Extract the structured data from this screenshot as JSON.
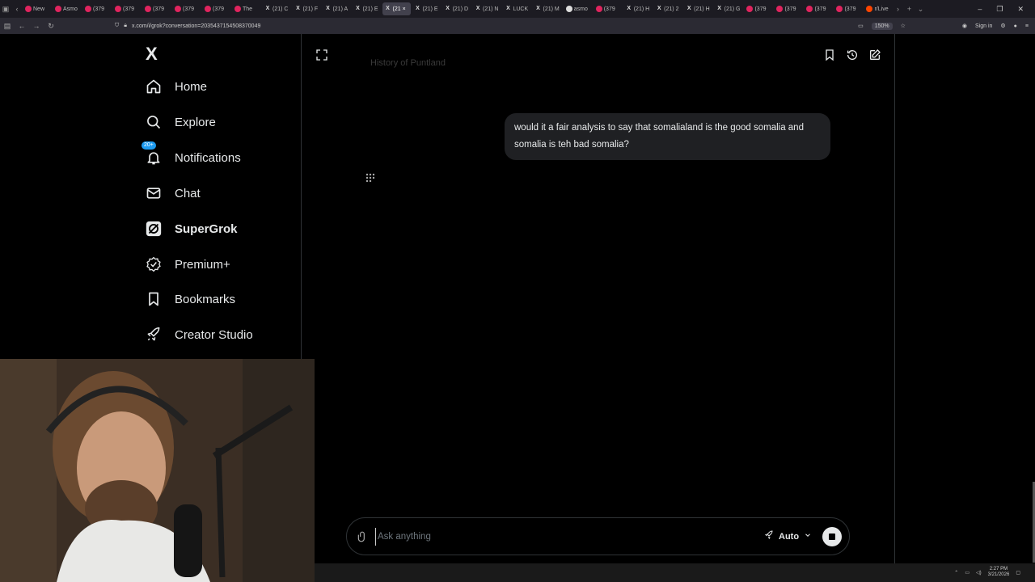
{
  "browser": {
    "tabs": [
      {
        "label": "New",
        "fav": "red"
      },
      {
        "label": "Asmo",
        "fav": "red"
      },
      {
        "label": "(379",
        "fav": "red"
      },
      {
        "label": "(379",
        "fav": "red"
      },
      {
        "label": "(379",
        "fav": "red"
      },
      {
        "label": "(379",
        "fav": "red"
      },
      {
        "label": "(379",
        "fav": "red"
      },
      {
        "label": "The",
        "fav": "red"
      },
      {
        "label": "(21) C",
        "fav": "x"
      },
      {
        "label": "(21) F",
        "fav": "x"
      },
      {
        "label": "(21) A",
        "fav": "x"
      },
      {
        "label": "(21) E",
        "fav": "x"
      },
      {
        "label": "(21",
        "fav": "x",
        "active": true
      },
      {
        "label": "(21) E",
        "fav": "x"
      },
      {
        "label": "(21) D",
        "fav": "x"
      },
      {
        "label": "(21) N",
        "fav": "x"
      },
      {
        "label": "LUCK",
        "fav": "x"
      },
      {
        "label": "(21) M",
        "fav": "x"
      },
      {
        "label": "asmo",
        "fav": "gr"
      },
      {
        "label": "(379",
        "fav": "red"
      },
      {
        "label": "(21) H",
        "fav": "x"
      },
      {
        "label": "(21) 2",
        "fav": "x"
      },
      {
        "label": "(21) H",
        "fav": "x"
      },
      {
        "label": "(21) G",
        "fav": "x"
      },
      {
        "label": "(379",
        "fav": "red"
      },
      {
        "label": "(379",
        "fav": "red"
      },
      {
        "label": "(379",
        "fav": "red"
      },
      {
        "label": "(379",
        "fav": "red"
      },
      {
        "label": "r/Live",
        "fav": "or"
      }
    ],
    "url": "x.com/i/grok?conversation=2035437154508370049",
    "zoom": "150%",
    "sign_in": "Sign in"
  },
  "sidebar": {
    "logo": "X",
    "items": [
      {
        "label": "Home",
        "icon": "home-icon"
      },
      {
        "label": "Explore",
        "icon": "search-icon"
      },
      {
        "label": "Notifications",
        "icon": "bell-icon",
        "badge": "20+"
      },
      {
        "label": "Chat",
        "icon": "mail-icon"
      },
      {
        "label": "SuperGrok",
        "icon": "grok-icon",
        "bold": true
      },
      {
        "label": "Premium+",
        "icon": "verified-icon"
      },
      {
        "label": "Bookmarks",
        "icon": "bookmark-icon"
      },
      {
        "label": "Creator Studio",
        "icon": "rocket-icon"
      }
    ]
  },
  "chat": {
    "faded_text": "History of Puntland",
    "user_message": "would it a fair analysis to say that somalialand is the good somalia and somalia is teh bad somalia?"
  },
  "composer": {
    "placeholder": "Ask anything",
    "mode_label": "Auto"
  },
  "taskbar": {
    "time": "2:27 PM",
    "date": "3/21/2026"
  },
  "colors": {
    "background": "#000000",
    "bubble": "#1f2023",
    "badge": "#1d9bf0",
    "border": "#2f3336"
  }
}
